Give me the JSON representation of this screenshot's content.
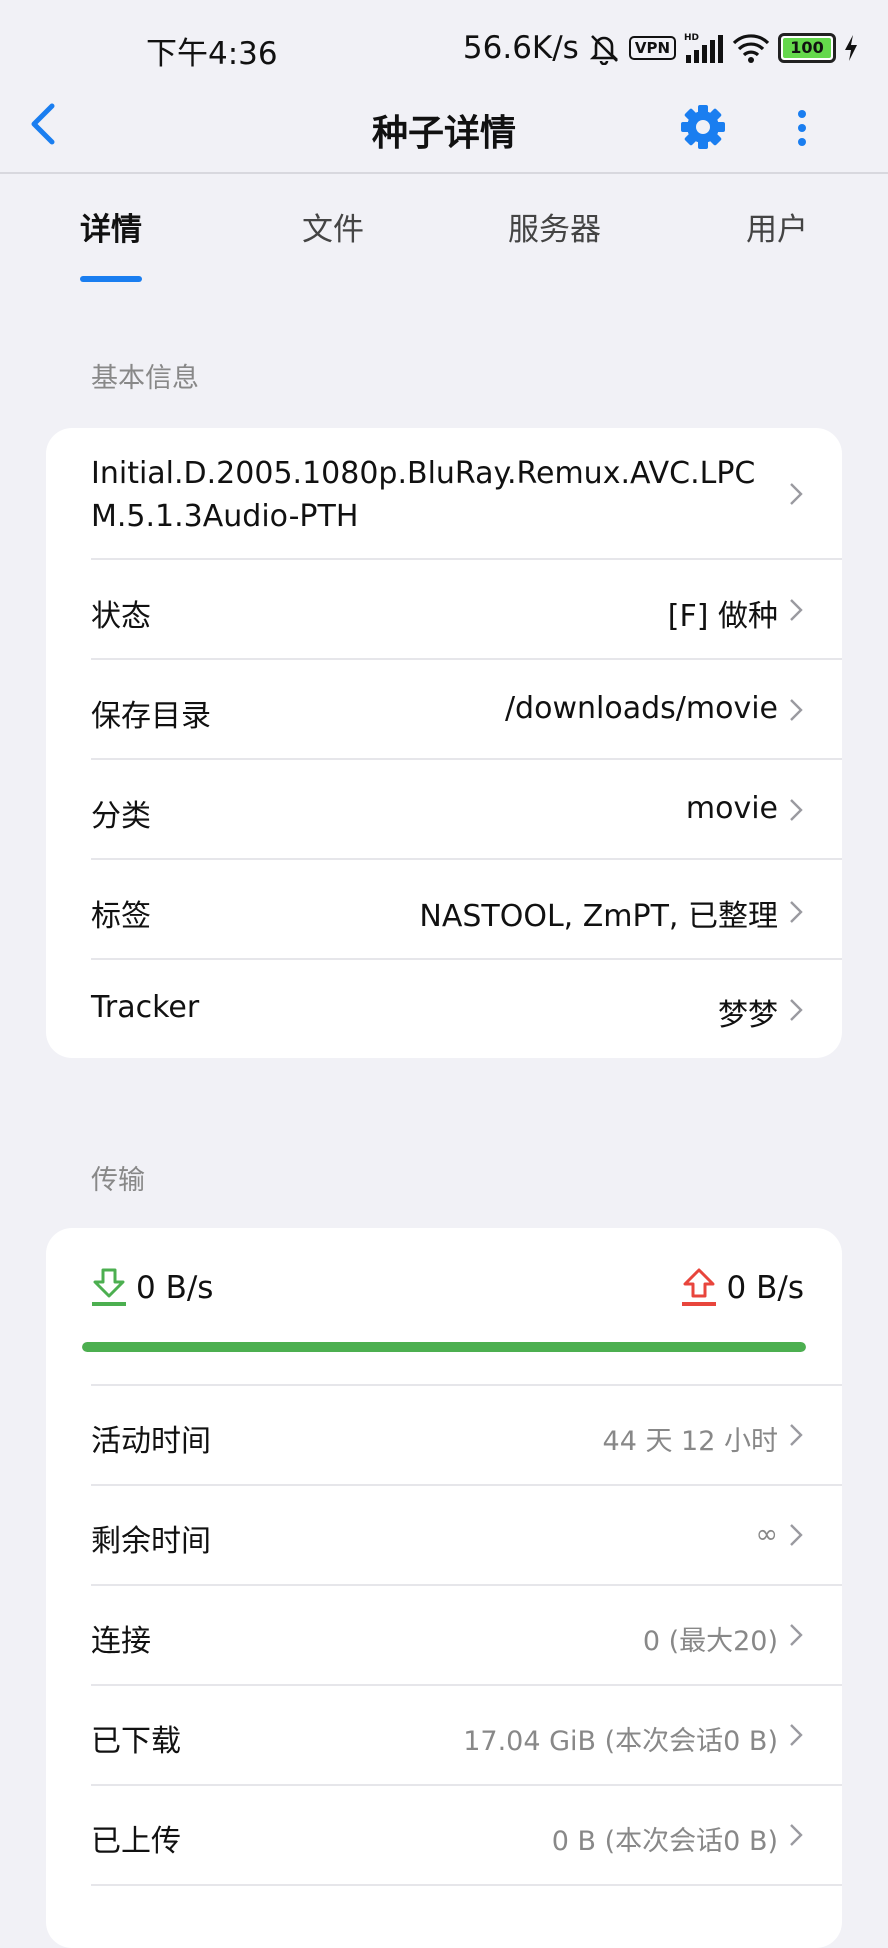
{
  "status_bar": {
    "time": "下午4:36",
    "net_speed": "56.6K/s",
    "vpn": "VPN",
    "hd": "HD",
    "battery": "100"
  },
  "nav": {
    "title": "种子详情"
  },
  "tabs": [
    "详情",
    "文件",
    "服务器",
    "用户"
  ],
  "basic_info": {
    "section_title": "基本信息",
    "torrent_name": "Initial.D.2005.1080p.BluRay.Remux.AVC.LPCM.5.1.3Audio-PTH",
    "rows": [
      {
        "label": "状态",
        "value": "[F] 做种"
      },
      {
        "label": "保存目录",
        "value": "/downloads/movie"
      },
      {
        "label": "分类",
        "value": "movie"
      },
      {
        "label": "标签",
        "value": "NASTOOL, ZmPT, 已整理"
      },
      {
        "label": "Tracker",
        "value": "梦梦"
      }
    ]
  },
  "transfer": {
    "section_title": "传输",
    "download_speed": "0 B/s",
    "upload_speed": "0 B/s",
    "progress": 1.0,
    "rows": [
      {
        "label": "活动时间",
        "value": "44 天 12 小时"
      },
      {
        "label": "剩余时间",
        "value": "∞"
      },
      {
        "label": "连接",
        "value": "0 (最大20)"
      },
      {
        "label": "已下载",
        "value": "17.04 GiB (本次会话0 B)"
      },
      {
        "label": "已上传",
        "value": "0 B (本次会话0 B)"
      }
    ]
  },
  "colors": {
    "accent": "#1a7ef0",
    "download": "#4caf50",
    "upload": "#e8453c",
    "progress": "#4caf50",
    "background": "#f1f1f6"
  }
}
